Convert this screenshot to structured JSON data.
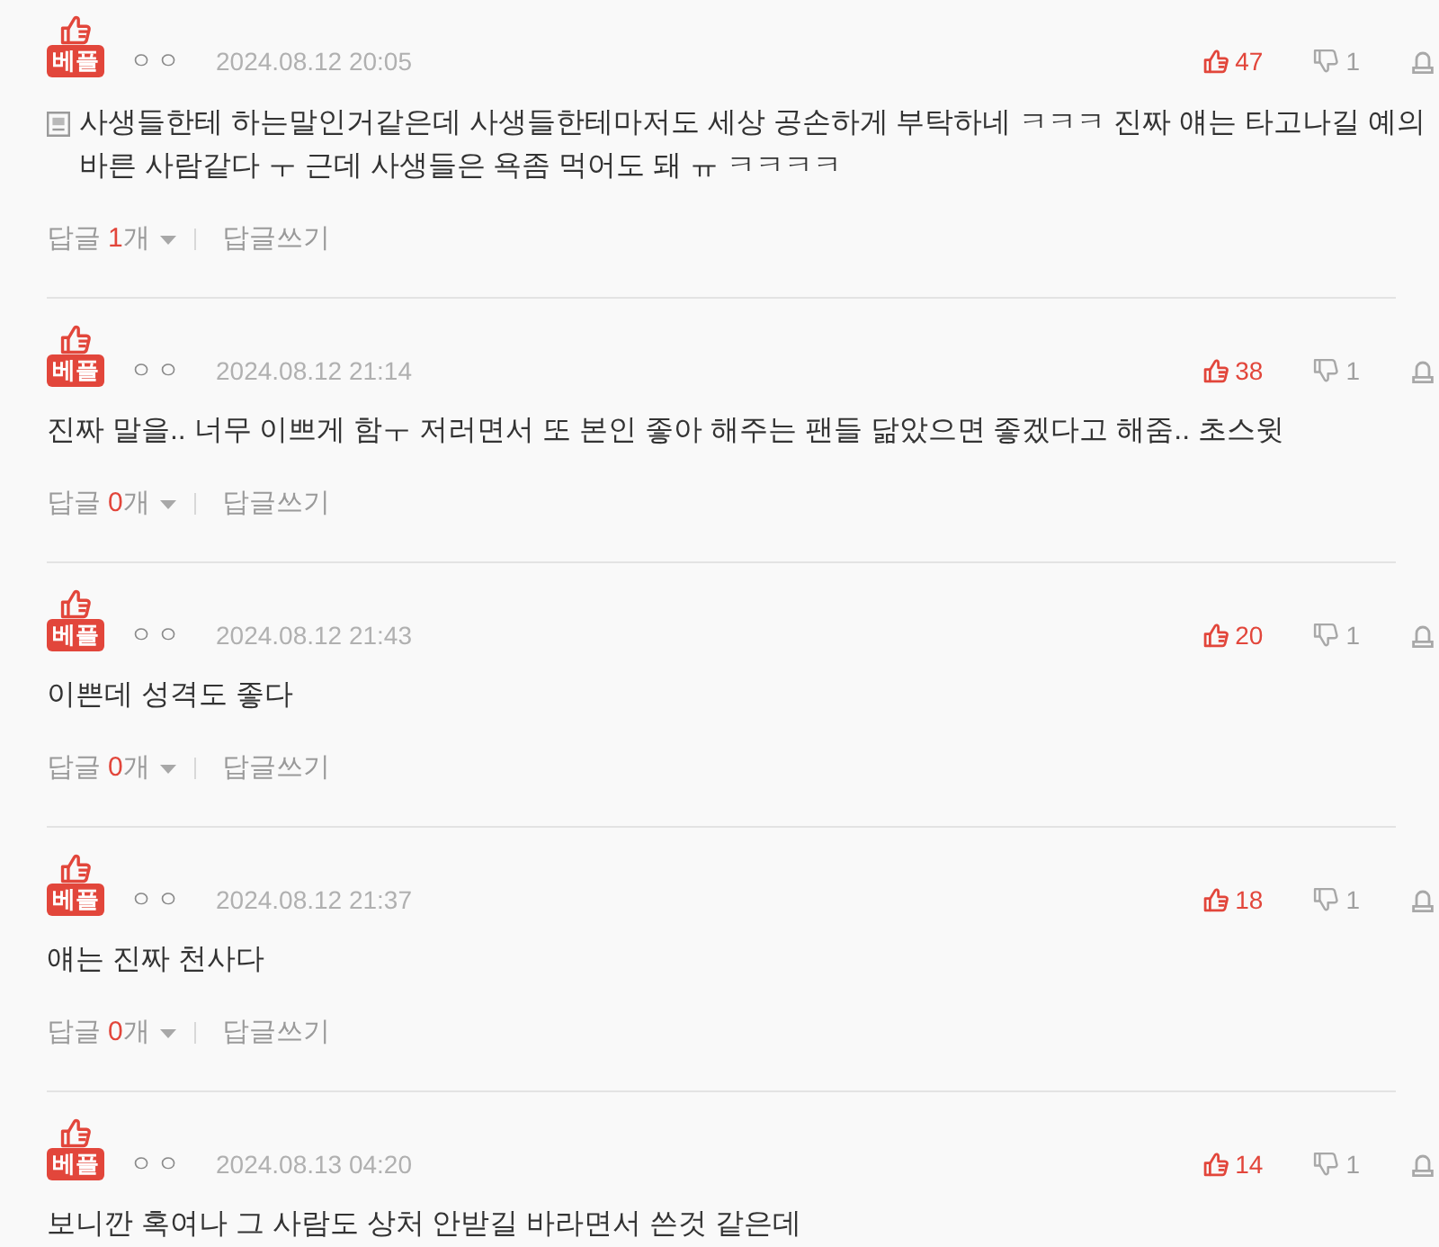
{
  "comments": [
    {
      "badge": "베플",
      "author": "ㅇㅇ",
      "date": "2024.08.12 20:05",
      "likes": "47",
      "dislikes": "1",
      "note_icon": true,
      "text": "사생들한테 하는말인거같은데 사생들한테마저도 세상 공손하게 부탁하네 ㅋㅋㅋ 진짜 얘는 타고나길 예의바른 사람같다 ㅜ 근데 사생들은 욕좀 먹어도 돼 ㅠ ㅋㅋㅋㅋ",
      "replies": {
        "label": "답글",
        "count": "1",
        "unit": "개",
        "write": "답글쓰기"
      }
    },
    {
      "badge": "베플",
      "author": "ㅇㅇ",
      "date": "2024.08.12 21:14",
      "likes": "38",
      "dislikes": "1",
      "note_icon": false,
      "text": "진짜 말을.. 너무 이쁘게 함ㅜ 저러면서 또 본인 좋아 해주는 팬들 닮았으면 좋겠다고 해줌.. 초스윗",
      "replies": {
        "label": "답글",
        "count": "0",
        "unit": "개",
        "write": "답글쓰기"
      }
    },
    {
      "badge": "베플",
      "author": "ㅇㅇ",
      "date": "2024.08.12 21:43",
      "likes": "20",
      "dislikes": "1",
      "note_icon": false,
      "text": "이쁜데 성격도 좋다",
      "replies": {
        "label": "답글",
        "count": "0",
        "unit": "개",
        "write": "답글쓰기"
      }
    },
    {
      "badge": "베플",
      "author": "ㅇㅇ",
      "date": "2024.08.12 21:37",
      "likes": "18",
      "dislikes": "1",
      "note_icon": false,
      "text": "얘는 진짜 천사다",
      "replies": {
        "label": "답글",
        "count": "0",
        "unit": "개",
        "write": "답글쓰기"
      }
    },
    {
      "badge": "베플",
      "author": "ㅇㅇ",
      "date": "2024.08.13 04:20",
      "likes": "14",
      "dislikes": "1",
      "note_icon": false,
      "text": "보니깐 혹여나 그 사람도 상처 안받길 바라면서 쓴것 같은데"
    }
  ]
}
